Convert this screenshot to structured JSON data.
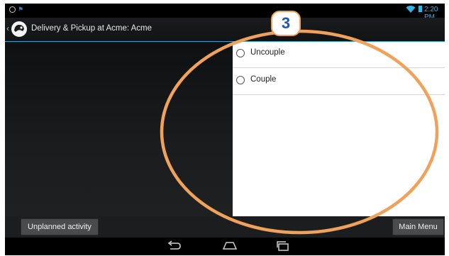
{
  "status_bar": {
    "clock": "2:20 PM"
  },
  "action_bar": {
    "title": "Delivery & Pickup at Acme: Acme"
  },
  "options": [
    {
      "label": "Uncouple",
      "selected": false
    },
    {
      "label": "Couple",
      "selected": false
    }
  ],
  "buttons": {
    "unplanned_activity": "Unplanned activity",
    "main_menu": "Main Menu"
  },
  "annotation": {
    "step_number": "3",
    "color": "#f0a25a"
  },
  "colors": {
    "accent": "#33b5e5",
    "annotation_orange": "#f0a25a",
    "badge_number": "#1a55b8"
  },
  "icons": [
    "notification-ring-icon",
    "notification-flag-icon",
    "wifi-icon",
    "battery-icon",
    "app-logo-icon",
    "back-icon",
    "home-icon",
    "recent-apps-icon"
  ]
}
